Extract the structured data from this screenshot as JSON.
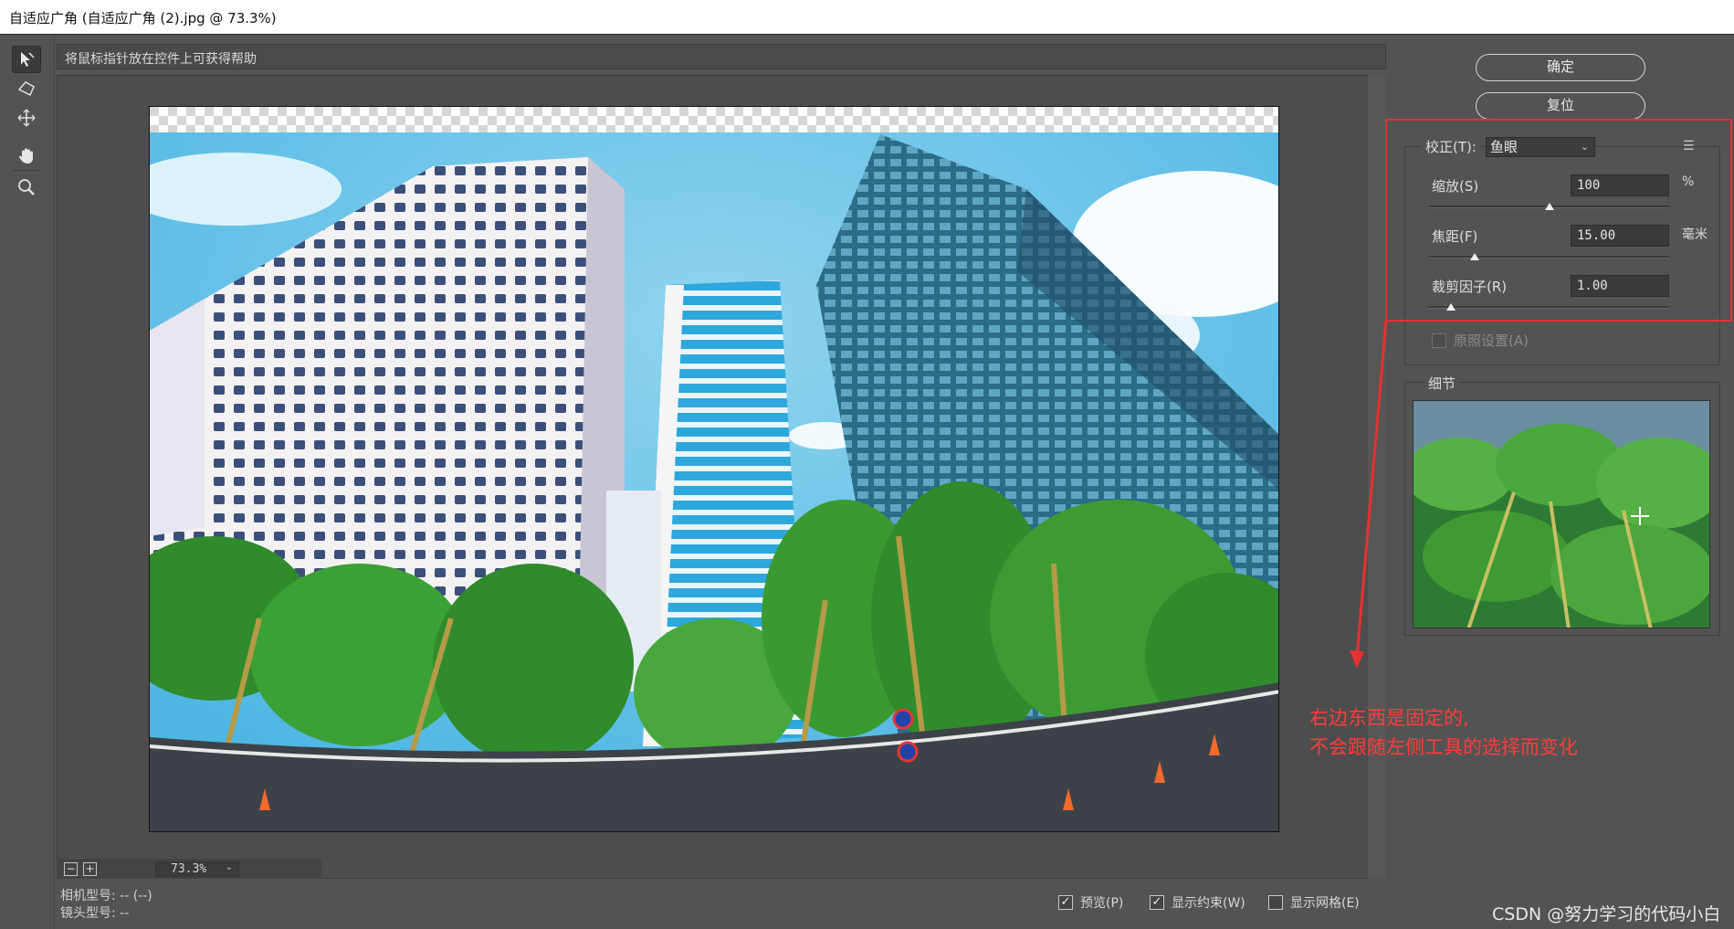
{
  "window": {
    "title": "自适应广角 (自适应广角 (2).jpg @ 73.3%)"
  },
  "toolbar": {
    "tools": [
      "constraint-tool",
      "polygon-constraint-tool",
      "move-tool",
      "hand-tool",
      "zoom-tool"
    ]
  },
  "hint": "将鼠标指针放在控件上可获得帮助",
  "zoom": {
    "minus": "−",
    "plus": "+",
    "value": "73.3%",
    "dropdown": "⌄"
  },
  "camera": {
    "model": "相机型号: -- (--)",
    "lens": "镜头型号: --"
  },
  "checkboxes": [
    {
      "label": "预览(P)",
      "checked": true
    },
    {
      "label": "显示约束(W)",
      "checked": true
    },
    {
      "label": "显示网格(E)",
      "checked": false
    }
  ],
  "buttons": {
    "ok": "确定",
    "reset": "复位"
  },
  "correction": {
    "label": "校正(T):",
    "value": "鱼眼",
    "menu_icon": "☰"
  },
  "sliders": [
    {
      "label": "缩放(S)",
      "value": "100",
      "unit": "%",
      "position": 0.5
    },
    {
      "label": "焦距(F)",
      "value": "15.00",
      "unit": "毫米",
      "position": 0.19
    },
    {
      "label": "裁剪因子(R)",
      "value": "1.00",
      "unit": "",
      "position": 0.09
    }
  ],
  "as_shot": {
    "label": "原照设置(A)",
    "checked": false
  },
  "detail": {
    "title": "细节"
  },
  "annotation": {
    "line1": "右边东西是固定的,",
    "line2": "不会跟随左侧工具的选择而变化"
  },
  "watermark": "CSDN @努力学习的代码小白",
  "colors": {
    "accent_red": "#e53232",
    "panel_bg": "#535353",
    "sky": "#6ec3e8"
  }
}
